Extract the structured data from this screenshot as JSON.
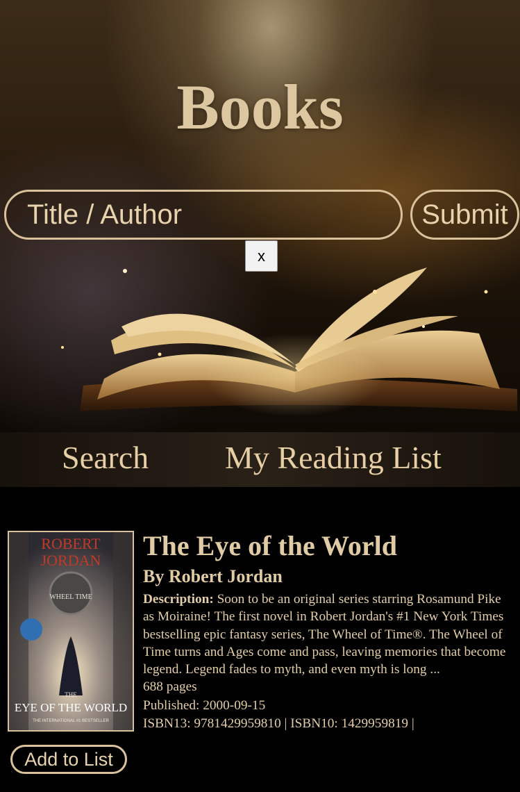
{
  "hero": {
    "title": "Books",
    "search": {
      "placeholder": "Title / Author",
      "value": ""
    },
    "submit_label": "Submit",
    "clear_label": "x"
  },
  "nav": {
    "items": [
      {
        "label": "Search"
      },
      {
        "label": "My Reading List"
      }
    ]
  },
  "results": [
    {
      "cover": {
        "author_line_1": "ROBERT",
        "author_line_2": "JORDAN",
        "series": "WHEEL TIME",
        "title_line_1": "THE",
        "title_line_2": "EYE OF THE WORLD",
        "tagline": "THE INTERNATIONAL #1 BESTSELLER"
      },
      "title": "The Eye of the World",
      "author": "By Robert Jordan",
      "description_label": "Description:",
      "description": "Soon to be an original series starring Rosamund Pike as Moiraine! The first novel in Robert Jordan's #1 New York Times bestselling epic fantasy series, The Wheel of Time®. The Wheel of Time turns and Ages come and pass, leaving memories that become legend. Legend fades to myth, and even myth is long ...",
      "pages": "688 pages",
      "published": "Published: 2000-09-15",
      "isbn": "ISBN13: 9781429959810 | ISBN10: 1429959819 |",
      "add_label": "Add to List"
    }
  ],
  "colors": {
    "accent": "#d9c29b",
    "text": "#e8d3ac",
    "background": "#000000"
  }
}
